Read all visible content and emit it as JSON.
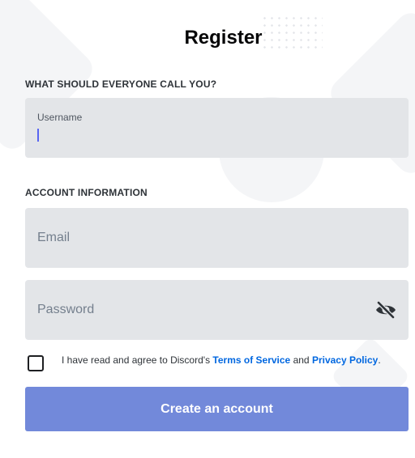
{
  "page": {
    "title": "Register"
  },
  "username_section": {
    "label": "WHAT SHOULD EVERYONE CALL YOU?",
    "field_caption": "Username",
    "value": ""
  },
  "account_section": {
    "label": "ACCOUNT INFORMATION",
    "email_placeholder": "Email",
    "password_placeholder": "Password",
    "password_toggle_icon": "eye-slash-icon"
  },
  "agreement": {
    "checked": false,
    "text_before": "I have read and agree to Discord's ",
    "terms_link": "Terms of Service",
    "text_middle": " and ",
    "privacy_link": "Privacy Policy",
    "text_after": "."
  },
  "submit": {
    "label": "Create an account"
  },
  "colors": {
    "button": "#7289da",
    "field_background": "#e3e5e8",
    "link": "#0067e0",
    "caret": "#5865f2"
  }
}
